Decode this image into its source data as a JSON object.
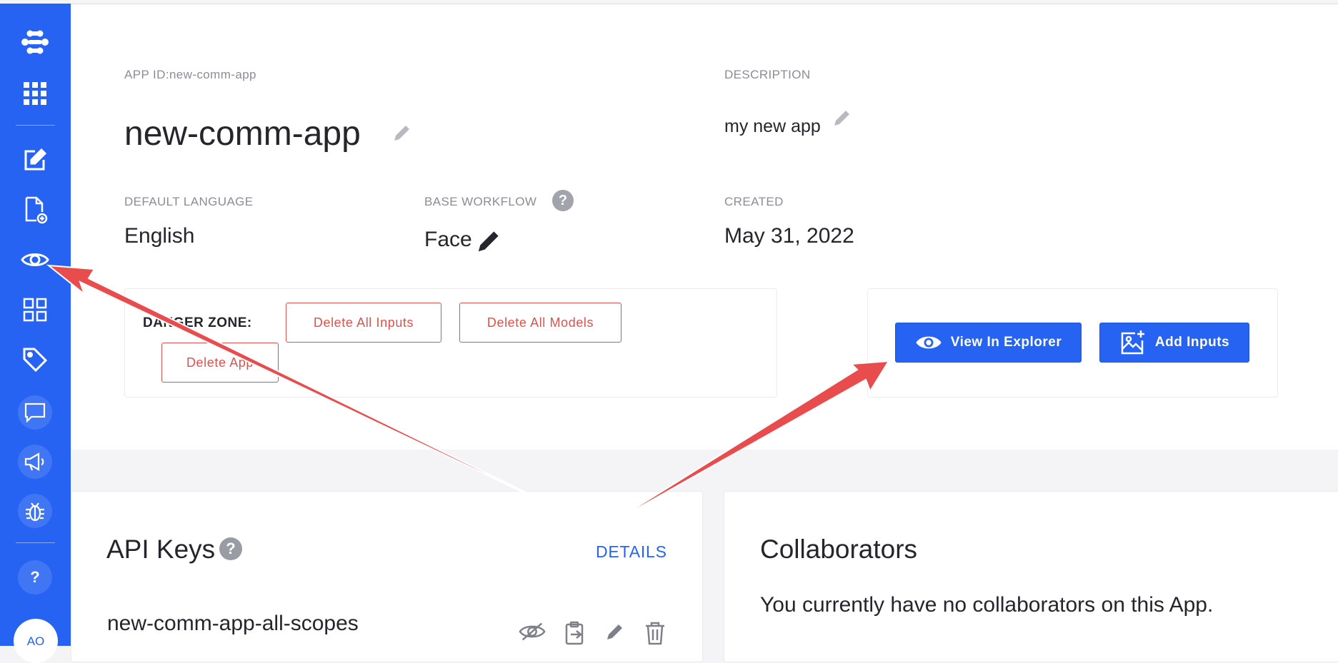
{
  "sidebar": {
    "items": [
      {
        "icon": "logo-icon"
      },
      {
        "icon": "apps-grid-icon"
      },
      {
        "icon": "edit-icon"
      },
      {
        "icon": "add-file-icon"
      },
      {
        "icon": "eye-icon"
      },
      {
        "icon": "modules-grid-icon"
      },
      {
        "icon": "tag-icon"
      },
      {
        "icon": "chat-icon"
      },
      {
        "icon": "megaphone-icon"
      },
      {
        "icon": "bug-icon"
      }
    ],
    "help_label": "?",
    "avatar_initials": "AO",
    "accent": "#2663f2"
  },
  "app": {
    "app_id_label": "APP ID:new-comm-app",
    "name": "new-comm-app",
    "description_label": "DESCRIPTION",
    "description": "my new app",
    "default_language_label": "DEFAULT LANGUAGE",
    "default_language": "English",
    "base_workflow_label": "BASE WORKFLOW",
    "base_workflow": "Face",
    "created_label": "CREATED",
    "created": "May 31, 2022"
  },
  "danger_zone": {
    "label": "DANGER ZONE:",
    "delete_inputs": "Delete All Inputs",
    "delete_models": "Delete All Models",
    "delete_app": "Delete App",
    "color": "#d9534f"
  },
  "actions": {
    "view_explorer": "View In Explorer",
    "add_inputs": "Add Inputs"
  },
  "api_keys": {
    "title": "API Keys",
    "help": "?",
    "details_link": "DETAILS",
    "keys": [
      {
        "name": "new-comm-app-all-scopes"
      }
    ]
  },
  "collaborators": {
    "title": "Collaborators",
    "empty_text": "You currently have no collaborators on this App."
  },
  "annotation": {
    "arrow_color": "#e84c4c"
  }
}
